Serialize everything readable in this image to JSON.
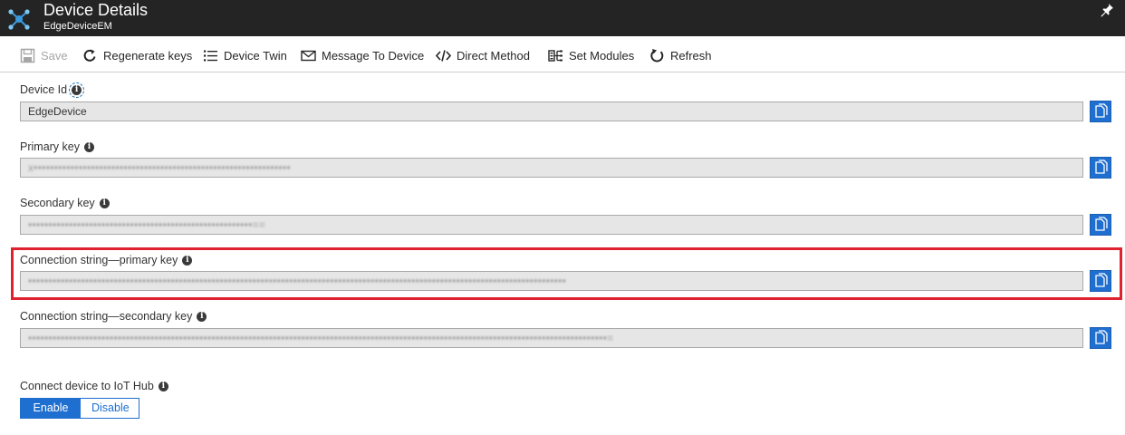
{
  "header": {
    "title": "Device Details",
    "subtitle": "EdgeDeviceEM",
    "app_icon": "iot-hub-icon",
    "pin_icon": "pin-icon"
  },
  "toolbar": {
    "save": "Save",
    "regenerate_keys": "Regenerate keys",
    "device_twin": "Device Twin",
    "message_to_device": "Message To Device",
    "direct_method": "Direct Method",
    "set_modules": "Set Modules",
    "refresh": "Refresh"
  },
  "fields": {
    "device_id": {
      "label": "Device Id",
      "value": "EdgeDevice"
    },
    "primary_key": {
      "label": "Primary key",
      "value": "x•••••••••••••••••••••••••••••••••••••••••••••••••••••••••••••••"
    },
    "secondary_key": {
      "label": "Secondary key",
      "value": "•••••••••••••••••••••••••••••••••••••••••••••••••••••••=="
    },
    "conn_primary": {
      "label": "Connection string—primary key",
      "value": "••••••••••••••••••••••••••••••••••••••••••••••••••••••••••••••••••••••••••••••••••••••••••••••••••••••••••••••••••••••••••••••••••••"
    },
    "conn_secondary": {
      "label": "Connection string—secondary key",
      "value": "••••••••••••••••••••••••••••••••••••••••••••••••••••••••••••••••••••••••••••••••••••••••••••••••••••••••••••••••••••••••••••••••••••••••••••••="
    }
  },
  "connect": {
    "label": "Connect device to IoT Hub",
    "enable": "Enable",
    "disable": "Disable",
    "selected": "Enable"
  },
  "colors": {
    "accent": "#1f6fd0",
    "highlight": "#e02130",
    "titlebar": "#242424"
  }
}
